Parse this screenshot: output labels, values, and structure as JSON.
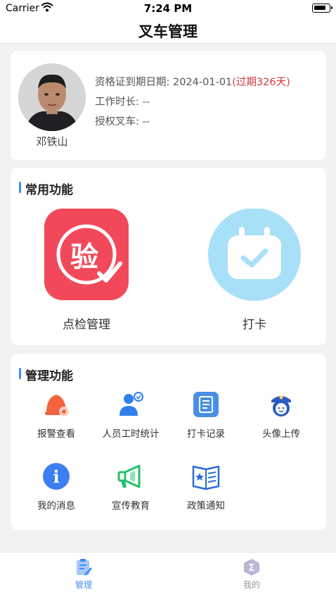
{
  "status_bar": {
    "carrier": "Carrier",
    "time": "7:24 PM"
  },
  "navbar": {
    "title": "叉车管理"
  },
  "profile": {
    "name": "邓铁山",
    "cert_label": "资格证到期日期: ",
    "cert_date": "2024-01-01",
    "cert_status": "(过期326天)",
    "work_hours_label": "工作时长: ",
    "work_hours_value": "--",
    "authorized_label": "授权叉车: ",
    "authorized_value": "--"
  },
  "common_functions": {
    "title": "常用功能",
    "items": [
      {
        "label": "点检管理",
        "icon": "inspection-icon",
        "glyph": "验",
        "color": "#f2495a"
      },
      {
        "label": "打卡",
        "icon": "checkin-calendar-icon",
        "color": "#a8e0f7"
      }
    ]
  },
  "management_functions": {
    "title": "管理功能",
    "items": [
      {
        "label": "报警查看",
        "icon": "alarm-bell-icon"
      },
      {
        "label": "人员工时统计",
        "icon": "staff-hours-icon"
      },
      {
        "label": "打卡记录",
        "icon": "checkin-record-icon"
      },
      {
        "label": "头像上传",
        "icon": "avatar-upload-icon"
      },
      {
        "label": "我的消息",
        "icon": "info-icon",
        "glyph": "i"
      },
      {
        "label": "宣传教育",
        "icon": "megaphone-icon"
      },
      {
        "label": "政策通知",
        "icon": "policy-book-icon"
      }
    ]
  },
  "tabbar": {
    "tabs": [
      {
        "label": "管理",
        "icon": "management-tab-icon",
        "active": true
      },
      {
        "label": "我的",
        "icon": "mine-tab-icon",
        "glyph": "Σ",
        "active": false
      }
    ]
  },
  "colors": {
    "accent": "#3f8cf4",
    "danger": "#d23a3a"
  }
}
